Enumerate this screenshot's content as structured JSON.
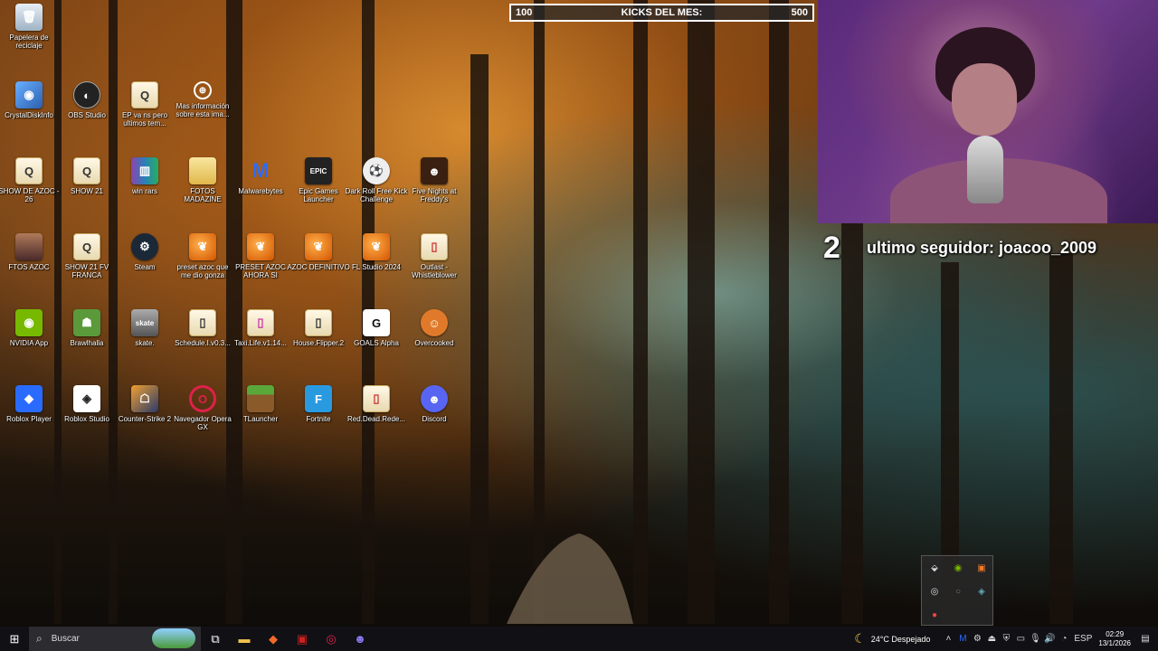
{
  "overlay": {
    "kicks_left": "100",
    "kicks_title": "KICKS DEL MES:",
    "kicks_right": "500",
    "follower_count": "2",
    "follower_text": "ultimo seguidor: joacoo_2009"
  },
  "desktop_icons": [
    {
      "label": "Papelera de reciclaje"
    },
    {
      "label": "CrystalDiskInfo"
    },
    {
      "label": "OBS Studio"
    },
    {
      "label": "EP va ns pero ultimos tem..."
    },
    {
      "label": "Mas información sobre esta ima..."
    },
    {
      "label": "SHOW DE AZOC - 26"
    },
    {
      "label": "SHOW 21"
    },
    {
      "label": "win rars"
    },
    {
      "label": "FOTOS MADAZINE"
    },
    {
      "label": "Malwarebytes"
    },
    {
      "label": "Epic Games Launcher"
    },
    {
      "label": "Dark Roll Free Kick Challenge"
    },
    {
      "label": "Five Nights at Freddy's"
    },
    {
      "label": "FTOS AZOC"
    },
    {
      "label": "SHOW 21 FV FRANCA"
    },
    {
      "label": "Steam"
    },
    {
      "label": "preset azoc que me dio gonza"
    },
    {
      "label": "PRESET AZOC AHORA SI"
    },
    {
      "label": "AZOC DEFINITIVO"
    },
    {
      "label": "FL Studio 2024"
    },
    {
      "label": "Outlast - Whistleblower"
    },
    {
      "label": "NVIDIA App"
    },
    {
      "label": "Brawlhalla"
    },
    {
      "label": "skate."
    },
    {
      "label": "Schedule.I.v0.3..."
    },
    {
      "label": "Taxi.Life.v1.14..."
    },
    {
      "label": "House.Flipper.2"
    },
    {
      "label": "GOALS Alpha"
    },
    {
      "label": "Overcooked"
    },
    {
      "label": "Roblox Player"
    },
    {
      "label": "Roblox Studio"
    },
    {
      "label": "Counter-Strike 2"
    },
    {
      "label": "Navegador Opera GX"
    },
    {
      "label": "TLauncher"
    },
    {
      "label": "Fortnite"
    },
    {
      "label": "Red.Dead.Rede..."
    },
    {
      "label": "Discord"
    }
  ],
  "taskbar": {
    "search_placeholder": "Buscar",
    "weather": "24°C  Despejado",
    "language": "ESP",
    "time": "02:29",
    "date": "13/1/2026"
  }
}
